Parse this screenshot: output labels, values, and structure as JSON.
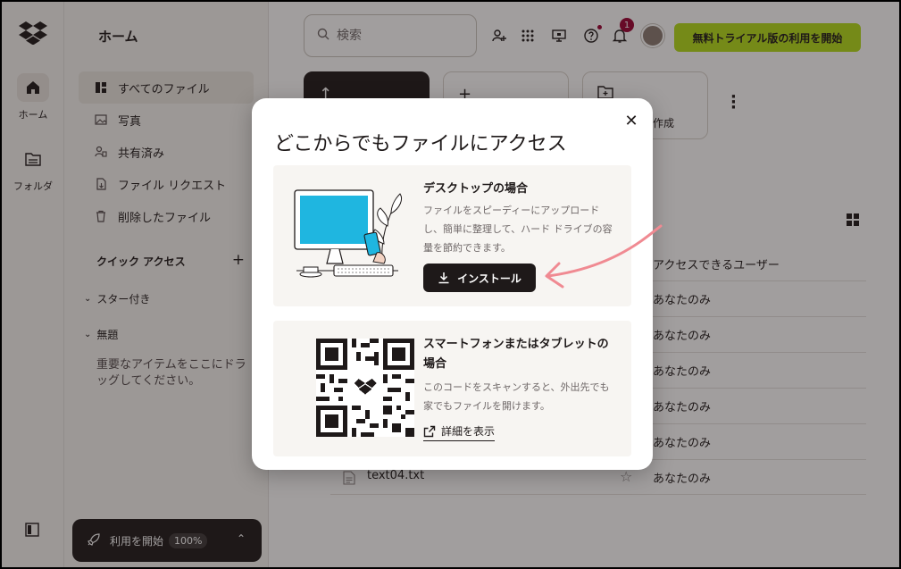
{
  "rail": {
    "home_label": "ホーム",
    "folders_label": "フォルダ"
  },
  "sidebar": {
    "title": "ホーム",
    "items": [
      {
        "label": "すべてのファイル",
        "icon": "all-files-icon"
      },
      {
        "label": "写真",
        "icon": "photo-icon"
      },
      {
        "label": "共有済み",
        "icon": "shared-icon"
      },
      {
        "label": "ファイル リクエスト",
        "icon": "file-request-icon"
      },
      {
        "label": "削除したファイル",
        "icon": "trash-icon"
      }
    ],
    "quick_access": "クイック アクセス",
    "quick_access_add": "+",
    "starred": "スター付き",
    "untitled": "無題",
    "hint": "重要なアイテムをここにドラッグしてください。",
    "start": {
      "label": "利用を開始",
      "percent": "100%"
    }
  },
  "header": {
    "search_placeholder": "検索",
    "notification_count": "1",
    "trial_button": "無料トライアル版の利用を開始"
  },
  "actions": {
    "create_label": "作成"
  },
  "table": {
    "access_header": "アクセスできるユーザー",
    "rows": [
      {
        "access": "あなたのみ",
        "name": ""
      },
      {
        "access": "あなたのみ",
        "name": ""
      },
      {
        "access": "あなたのみ",
        "name": ""
      },
      {
        "access": "あなたのみ",
        "name": ""
      },
      {
        "access": "あなたのみ",
        "name": ""
      },
      {
        "access": "あなたのみ",
        "name": "text04.txt"
      }
    ]
  },
  "modal": {
    "title": "どこからでもファイルにアクセス",
    "desktop": {
      "heading": "デスクトップの場合",
      "body": "ファイルをスピーディーにアップロードし、簡単に整理して、ハード ドライブの容量を節約できます。",
      "install_label": "インストール"
    },
    "mobile": {
      "heading": "スマートフォンまたはタブレットの場合",
      "body": "このコードをスキャンすると、外出先でも家でもファイルを開けます。",
      "details_label": "詳細を表示"
    }
  },
  "colors": {
    "accent_green": "#b4dc19",
    "badge_red": "#9b0032",
    "arrow_pink": "#f08a92",
    "screen_blue": "#1fb6e0"
  }
}
